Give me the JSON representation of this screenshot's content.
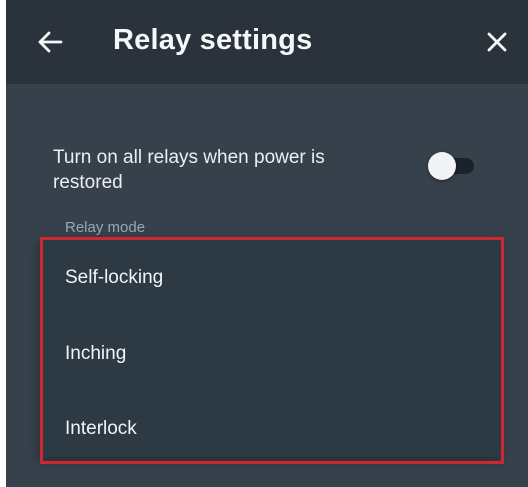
{
  "header": {
    "title": "Relay settings",
    "back_icon": "arrow-left-icon",
    "close_icon": "close-icon"
  },
  "power_restore": {
    "label": "Turn on all relays when power is restored",
    "toggle_state": "off"
  },
  "relay_mode": {
    "label": "Relay mode",
    "options": [
      {
        "label": "Self-locking"
      },
      {
        "label": "Inching"
      },
      {
        "label": "Interlock"
      }
    ]
  },
  "colors": {
    "header_bg": "#2a333b",
    "screen_bg": "#36414c",
    "menu_bg": "#2d3943",
    "highlight_border": "#d0262e"
  }
}
